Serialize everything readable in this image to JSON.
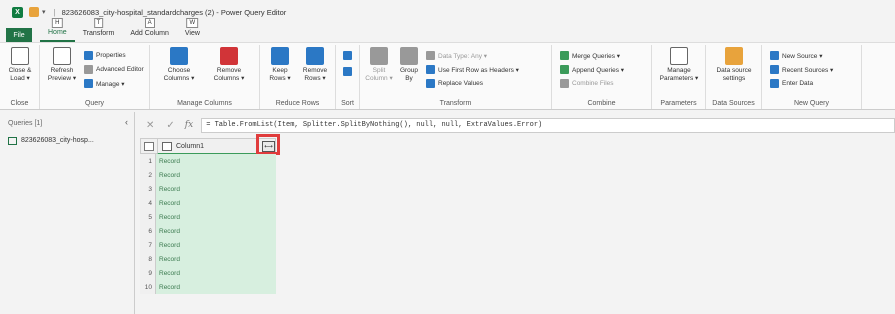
{
  "window": {
    "app_logo": "X",
    "title": "823626083_city-hospital_standardcharges (2) - Power Query Editor"
  },
  "tabs": {
    "file": "File",
    "items": [
      {
        "label": "Home",
        "keytip": "H",
        "active": true
      },
      {
        "label": "Transform",
        "keytip": "T",
        "active": false
      },
      {
        "label": "Add Column",
        "keytip": "A",
        "active": false
      },
      {
        "label": "View",
        "keytip": "W",
        "active": false
      }
    ]
  },
  "ribbon": {
    "close_group": {
      "label": "Close",
      "close_load": "Close & Load ▾"
    },
    "query_group": {
      "label": "Query",
      "refresh": "Refresh Preview ▾",
      "properties": "Properties",
      "advanced_editor": "Advanced Editor",
      "manage": "Manage ▾"
    },
    "manage_columns_group": {
      "label": "Manage Columns",
      "choose": "Choose Columns ▾",
      "remove": "Remove Columns ▾"
    },
    "reduce_rows_group": {
      "label": "Reduce Rows",
      "keep": "Keep Rows ▾",
      "remove": "Remove Rows ▾"
    },
    "sort_group": {
      "label": "Sort"
    },
    "transform_group": {
      "label": "Transform",
      "split": "Split Column ▾",
      "group_by": "Group By",
      "data_type": "Data Type: Any ▾",
      "first_row": "Use First Row as Headers ▾",
      "replace": "Replace Values"
    },
    "combine_group": {
      "label": "Combine",
      "merge": "Merge Queries ▾",
      "append": "Append Queries ▾",
      "combine_files": "Combine Files"
    },
    "parameters_group": {
      "label": "Parameters",
      "manage": "Manage Parameters ▾"
    },
    "data_sources_group": {
      "label": "Data Sources",
      "settings": "Data source settings"
    },
    "new_query_group": {
      "label": "New Query",
      "new_source": "New Source ▾",
      "recent": "Recent Sources ▾",
      "enter_data": "Enter Data"
    }
  },
  "queries_pane": {
    "title": "Queries [1]",
    "collapse": "‹",
    "item": "823626083_city-hosp..."
  },
  "formula_bar": {
    "cancel": "✕",
    "confirm": "✓",
    "fx": "fx",
    "formula": "= Table.FromList(Item, Splitter.SplitByNothing(), null, null, ExtraValues.Error)"
  },
  "grid": {
    "column_name": "Column1",
    "expand_label": "⟷",
    "rows": [
      {
        "n": "1",
        "v": "Record"
      },
      {
        "n": "2",
        "v": "Record"
      },
      {
        "n": "3",
        "v": "Record"
      },
      {
        "n": "4",
        "v": "Record"
      },
      {
        "n": "5",
        "v": "Record"
      },
      {
        "n": "6",
        "v": "Record"
      },
      {
        "n": "7",
        "v": "Record"
      },
      {
        "n": "8",
        "v": "Record"
      },
      {
        "n": "9",
        "v": "Record"
      },
      {
        "n": "10",
        "v": "Record"
      }
    ]
  },
  "colors": {
    "accent": "#217346",
    "highlight": "#e03c3c",
    "cell_bg": "#d7efdf"
  }
}
